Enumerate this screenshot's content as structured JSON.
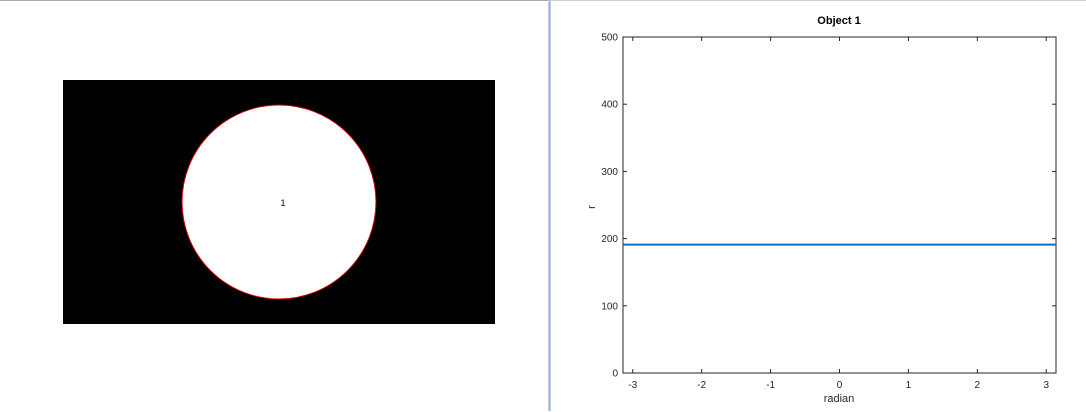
{
  "image_panel": {
    "object_label": "1",
    "background_color": "#000000",
    "object_color": "#ffffff",
    "boundary_color": "#cc0000"
  },
  "chart_data": {
    "type": "line",
    "title": "Object 1",
    "xlabel": "radian",
    "ylabel": "r",
    "xlim": [
      -3.14159,
      3.14159
    ],
    "ylim": [
      0,
      500
    ],
    "xticks": [
      -3,
      -2,
      -1,
      0,
      1,
      2,
      3
    ],
    "yticks": [
      0,
      100,
      200,
      300,
      400,
      500
    ],
    "grid": false,
    "series": [
      {
        "color": "#0072bd",
        "x": [
          -3.14159,
          -2.5,
          -2,
          -1.5,
          -1,
          -0.5,
          0,
          0.5,
          1,
          1.5,
          2,
          2.5,
          3.14159
        ],
        "y": [
          191,
          191,
          191,
          191,
          191,
          191,
          191,
          191,
          191,
          191,
          191,
          191,
          191
        ]
      }
    ]
  }
}
